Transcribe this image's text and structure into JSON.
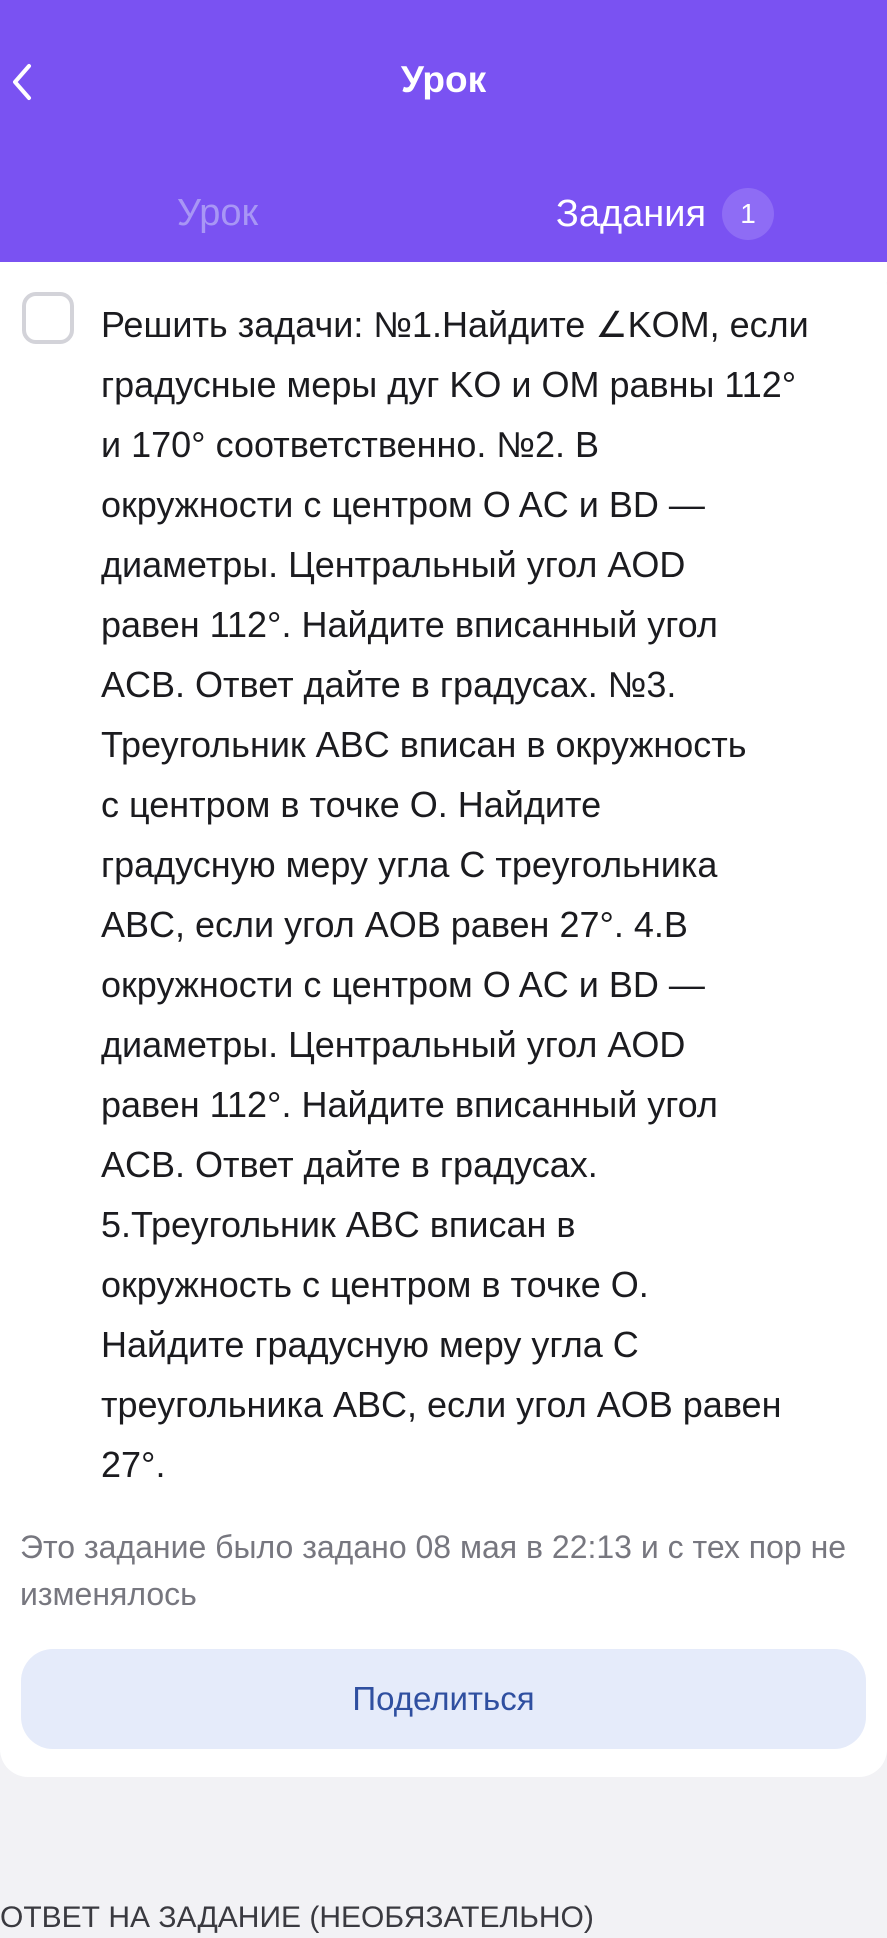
{
  "header": {
    "title": "Урок",
    "back_icon": "chevron-left-icon",
    "background_color": "#7a52f2"
  },
  "tabs": [
    {
      "label": "Урок",
      "active": false
    },
    {
      "label": "Задания",
      "active": true,
      "badge": "1"
    }
  ],
  "task": {
    "checked": false,
    "text": "Решить задачи: №1.Найдите ∠KOM, если\nградусные меры дуг KO и OM равны 112°\nи 170° соответственно. №2. В\nокружности с центром O AC и BD —\nдиаметры. Центральный угол AOD\nравен 112°. Найдите вписанный угол\nACB. Ответ дайте в градусах. №3.\nТреугольник ABC вписан в окружность\nс центром в точке O. Найдите\nградусную меру угла C треугольника\nABC, если угол AOB равен 27°.  4.В\nокружности с центром O AC и BD —\nдиаметры. Центральный угол AOD\nравен 112°. Найдите вписанный угол\nACB. Ответ дайте в градусах.\n5.Треугольник ABC вписан в\nокружность с центром в точке O.\nНайдите градусную меру угла C\nтреугольника ABC, если угол AOB равен\n27°."
  },
  "note": "Это задание было задано 08 мая в 22:13 и с тех пор не изменялось",
  "share_button": "Поделиться",
  "answer_section_label": "ОТВЕТ НА ЗАДАНИЕ (НЕОБЯЗАТЕЛЬНО)"
}
